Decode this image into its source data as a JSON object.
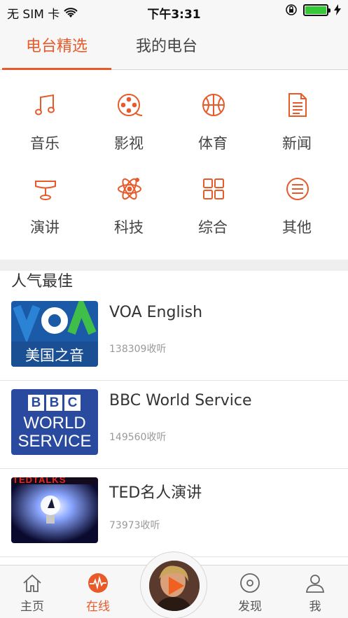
{
  "status": {
    "carrier": "无 SIM 卡",
    "time": "下午3:31"
  },
  "tabs": [
    {
      "label": "电台精选"
    },
    {
      "label": "我的电台"
    }
  ],
  "categories": [
    {
      "label": "音乐",
      "icon": "music-note-icon"
    },
    {
      "label": "影视",
      "icon": "film-reel-icon"
    },
    {
      "label": "体育",
      "icon": "basketball-icon"
    },
    {
      "label": "新闻",
      "icon": "document-icon"
    },
    {
      "label": "演讲",
      "icon": "podium-icon"
    },
    {
      "label": "科技",
      "icon": "atom-icon"
    },
    {
      "label": "综合",
      "icon": "grid-icon"
    },
    {
      "label": "其他",
      "icon": "menu-circle-icon"
    }
  ],
  "section": {
    "title": "人气最佳"
  },
  "stations": [
    {
      "title": "VOA English",
      "listeners": "138309收听",
      "logo_text": "美国之音",
      "logo_top": "VOA"
    },
    {
      "title": "BBC World Service",
      "listeners": "149560收听",
      "logo_lines": [
        "BBC",
        "WORLD",
        "SERVICE"
      ]
    },
    {
      "title": "TED名人演讲",
      "listeners": "73973收听",
      "logo_top": "TEDTALKS"
    }
  ],
  "tabbar": [
    {
      "label": "主页",
      "icon": "home-icon"
    },
    {
      "label": "在线",
      "icon": "radio-wave-icon"
    },
    {
      "label": "发现",
      "icon": "disc-icon"
    },
    {
      "label": "我",
      "icon": "user-icon"
    }
  ],
  "colors": {
    "accent": "#e85a2a",
    "voa_blue": "#1a5aa6",
    "bbc_blue": "#2a4aa0"
  }
}
